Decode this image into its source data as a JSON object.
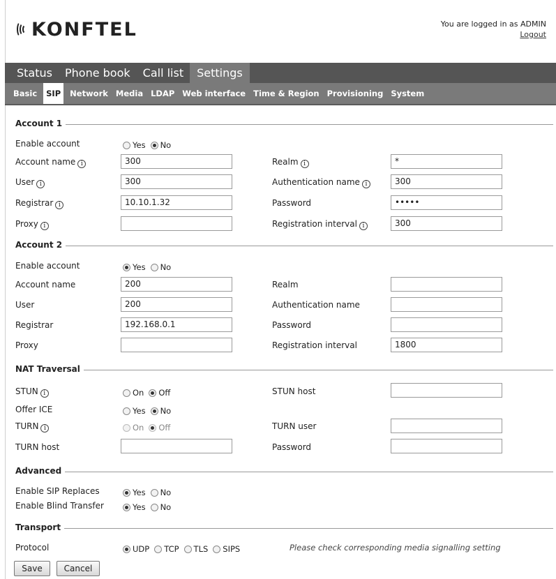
{
  "header": {
    "logo_text": "KONFTEL",
    "logged_in_text": "You are logged in as ADMIN",
    "logout_label": "Logout"
  },
  "main_nav": [
    "Status",
    "Phone book",
    "Call list",
    "Settings"
  ],
  "sub_nav": [
    "Basic",
    "SIP",
    "Network",
    "Media",
    "LDAP",
    "Web interface",
    "Time & Region",
    "Provisioning",
    "System"
  ],
  "account1": {
    "title": "Account 1",
    "enable_label": "Enable account",
    "yes": "Yes",
    "no": "No",
    "account_name_label": "Account name",
    "account_name": "300",
    "user_label": "User",
    "user": "300",
    "registrar_label": "Registrar",
    "registrar": "10.10.1.32",
    "proxy_label": "Proxy",
    "proxy": "",
    "realm_label": "Realm",
    "realm": "*",
    "auth_name_label": "Authentication name",
    "auth_name": "300",
    "password_label": "Password",
    "password": "•••••",
    "reg_interval_label": "Registration interval",
    "reg_interval": "300"
  },
  "account2": {
    "title": "Account 2",
    "enable_label": "Enable account",
    "yes": "Yes",
    "no": "No",
    "account_name_label": "Account name",
    "account_name": "200",
    "user_label": "User",
    "user": "200",
    "registrar_label": "Registrar",
    "registrar": "192.168.0.1",
    "proxy_label": "Proxy",
    "proxy": "",
    "realm_label": "Realm",
    "realm": "",
    "auth_name_label": "Authentication name",
    "auth_name": "",
    "password_label": "Password",
    "password": "",
    "reg_interval_label": "Registration interval",
    "reg_interval": "1800"
  },
  "nat": {
    "title": "NAT Traversal",
    "stun_label": "STUN",
    "on": "On",
    "off": "Off",
    "stun_host_label": "STUN host",
    "stun_host": "",
    "offer_ice_label": "Offer ICE",
    "yes": "Yes",
    "no": "No",
    "turn_label": "TURN",
    "turn_user_label": "TURN user",
    "turn_user": "",
    "turn_host_label": "TURN host",
    "turn_host": "",
    "password_label": "Password",
    "password": ""
  },
  "advanced": {
    "title": "Advanced",
    "sip_replaces_label": "Enable SIP Replaces",
    "blind_transfer_label": "Enable Blind Transfer",
    "yes": "Yes",
    "no": "No"
  },
  "transport": {
    "title": "Transport",
    "protocol_label": "Protocol",
    "options": [
      "UDP",
      "TCP",
      "TLS",
      "SIPS"
    ],
    "note": "Please check corresponding media signalling setting"
  },
  "buttons": {
    "save": "Save",
    "cancel": "Cancel"
  }
}
